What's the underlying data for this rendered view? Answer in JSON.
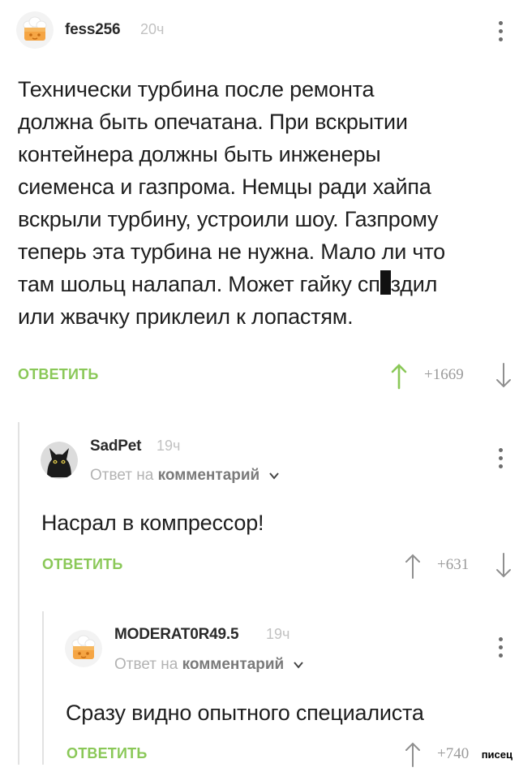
{
  "comments": [
    {
      "username": "fess256",
      "time": "20ч",
      "text_lines": [
        "Технически турбина после ремонта",
        "должна быть опечатана. При вскрытии",
        "контейнера должны быть инженеры",
        "сиеменса и газпрома. Немцы ради хайпа",
        "вскрыли турбину, устроили шоу. Газпрому",
        "теперь эта турбина не нужна. Мало ли что",
        "там шольц налапал. Может гайку сп",
        "или жвачку приклеил к лопастям."
      ],
      "text_line7_tail": "здил",
      "reply_label": "ОТВЕТИТЬ",
      "rating": "+1669",
      "avatar_icon": "chef-hat-avatar-icon"
    },
    {
      "username": "SadPet",
      "time": "19ч",
      "reply_to_prefix": "Ответ на",
      "reply_to_link": "комментарий",
      "text": "Насрал в компрессор!",
      "reply_label": "ОТВЕТИТЬ",
      "rating": "+631",
      "avatar_icon": "black-cat-avatar-icon"
    },
    {
      "username": "MODERAT0R49.5",
      "time": "19ч",
      "reply_to_prefix": "Ответ на",
      "reply_to_link": "комментарий",
      "text": "Сразу видно опытного специалиста",
      "reply_label": "ОТВЕТИТЬ",
      "rating": "+740",
      "avatar_icon": "chef-hat-avatar-icon"
    }
  ],
  "watermark": "писец",
  "colors": {
    "accent_green": "#8ac858",
    "username": "#2a2a2a",
    "muted": "#b3b3b3",
    "thread_line": "#e2e2e2"
  }
}
